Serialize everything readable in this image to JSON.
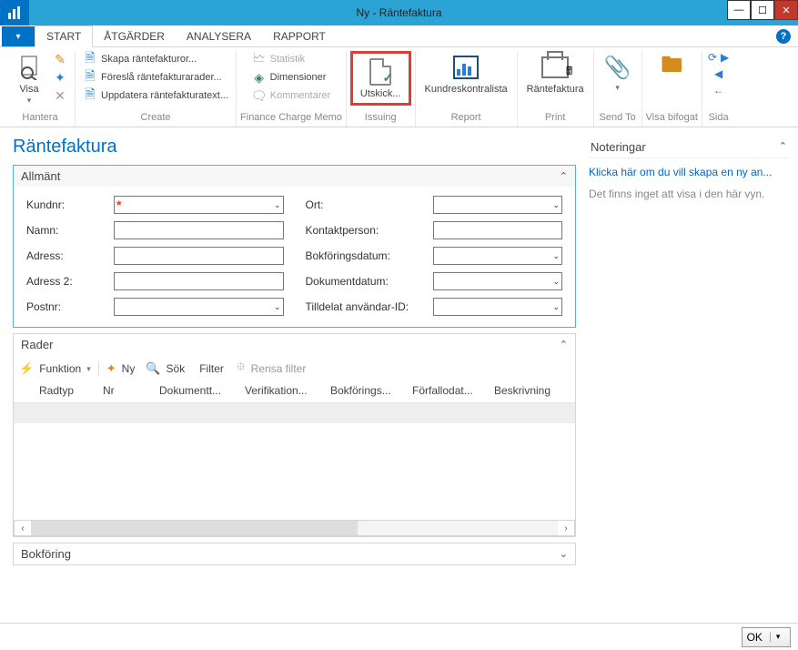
{
  "window": {
    "title": "Ny - Räntefaktura"
  },
  "tabs": {
    "start": "START",
    "atgarder": "ÅTGÄRDER",
    "analysera": "ANALYSERA",
    "rapport": "RAPPORT"
  },
  "ribbon": {
    "hantera": {
      "label": "Hantera",
      "visa": "Visa"
    },
    "create": {
      "label": "Create",
      "skapa": "Skapa räntefakturor...",
      "foresla": "Föreslå räntefakturarader...",
      "uppdatera": "Uppdatera räntefakturatext..."
    },
    "fcm": {
      "label": "Finance Charge Memo",
      "statistik": "Statistik",
      "dimensioner": "Dimensioner",
      "kommentarer": "Kommentarer"
    },
    "issuing": {
      "label": "Issuing",
      "utskick": "Utskick..."
    },
    "report": {
      "label": "Report",
      "kundres": "Kundreskontralista"
    },
    "print": {
      "label": "Print",
      "rantefaktura": "Räntefaktura"
    },
    "sendto": {
      "label": "Send To"
    },
    "visabifogat": {
      "label": "Visa bifogat"
    },
    "sida": {
      "label": "Sida"
    }
  },
  "page": {
    "title": "Räntefaktura"
  },
  "allmant": {
    "header": "Allmänt",
    "kundnr": "Kundnr:",
    "namn": "Namn:",
    "adress": "Adress:",
    "adress2": "Adress 2:",
    "postnr": "Postnr:",
    "ort": "Ort:",
    "kontakt": "Kontaktperson:",
    "bokforingsdatum": "Bokföringsdatum:",
    "dokumentdatum": "Dokumentdatum:",
    "tilldelat": "Tilldelat användar-ID:"
  },
  "rader": {
    "header": "Rader",
    "funktion": "Funktion",
    "ny": "Ny",
    "sok": "Sök",
    "filter": "Filter",
    "rensa": "Rensa filter",
    "cols": {
      "radtyp": "Radtyp",
      "nr": "Nr",
      "dokument": "Dokumentt...",
      "verifikation": "Verifikation...",
      "bokforings": "Bokförings...",
      "forfallodat": "Förfallodat...",
      "beskrivning": "Beskrivning"
    }
  },
  "bokforing": {
    "header": "Bokföring"
  },
  "noteringar": {
    "header": "Noteringar",
    "link": "Klicka här om du vill skapa en ny an...",
    "empty": "Det finns inget att visa i den här vyn."
  },
  "footer": {
    "ok": "OK"
  }
}
